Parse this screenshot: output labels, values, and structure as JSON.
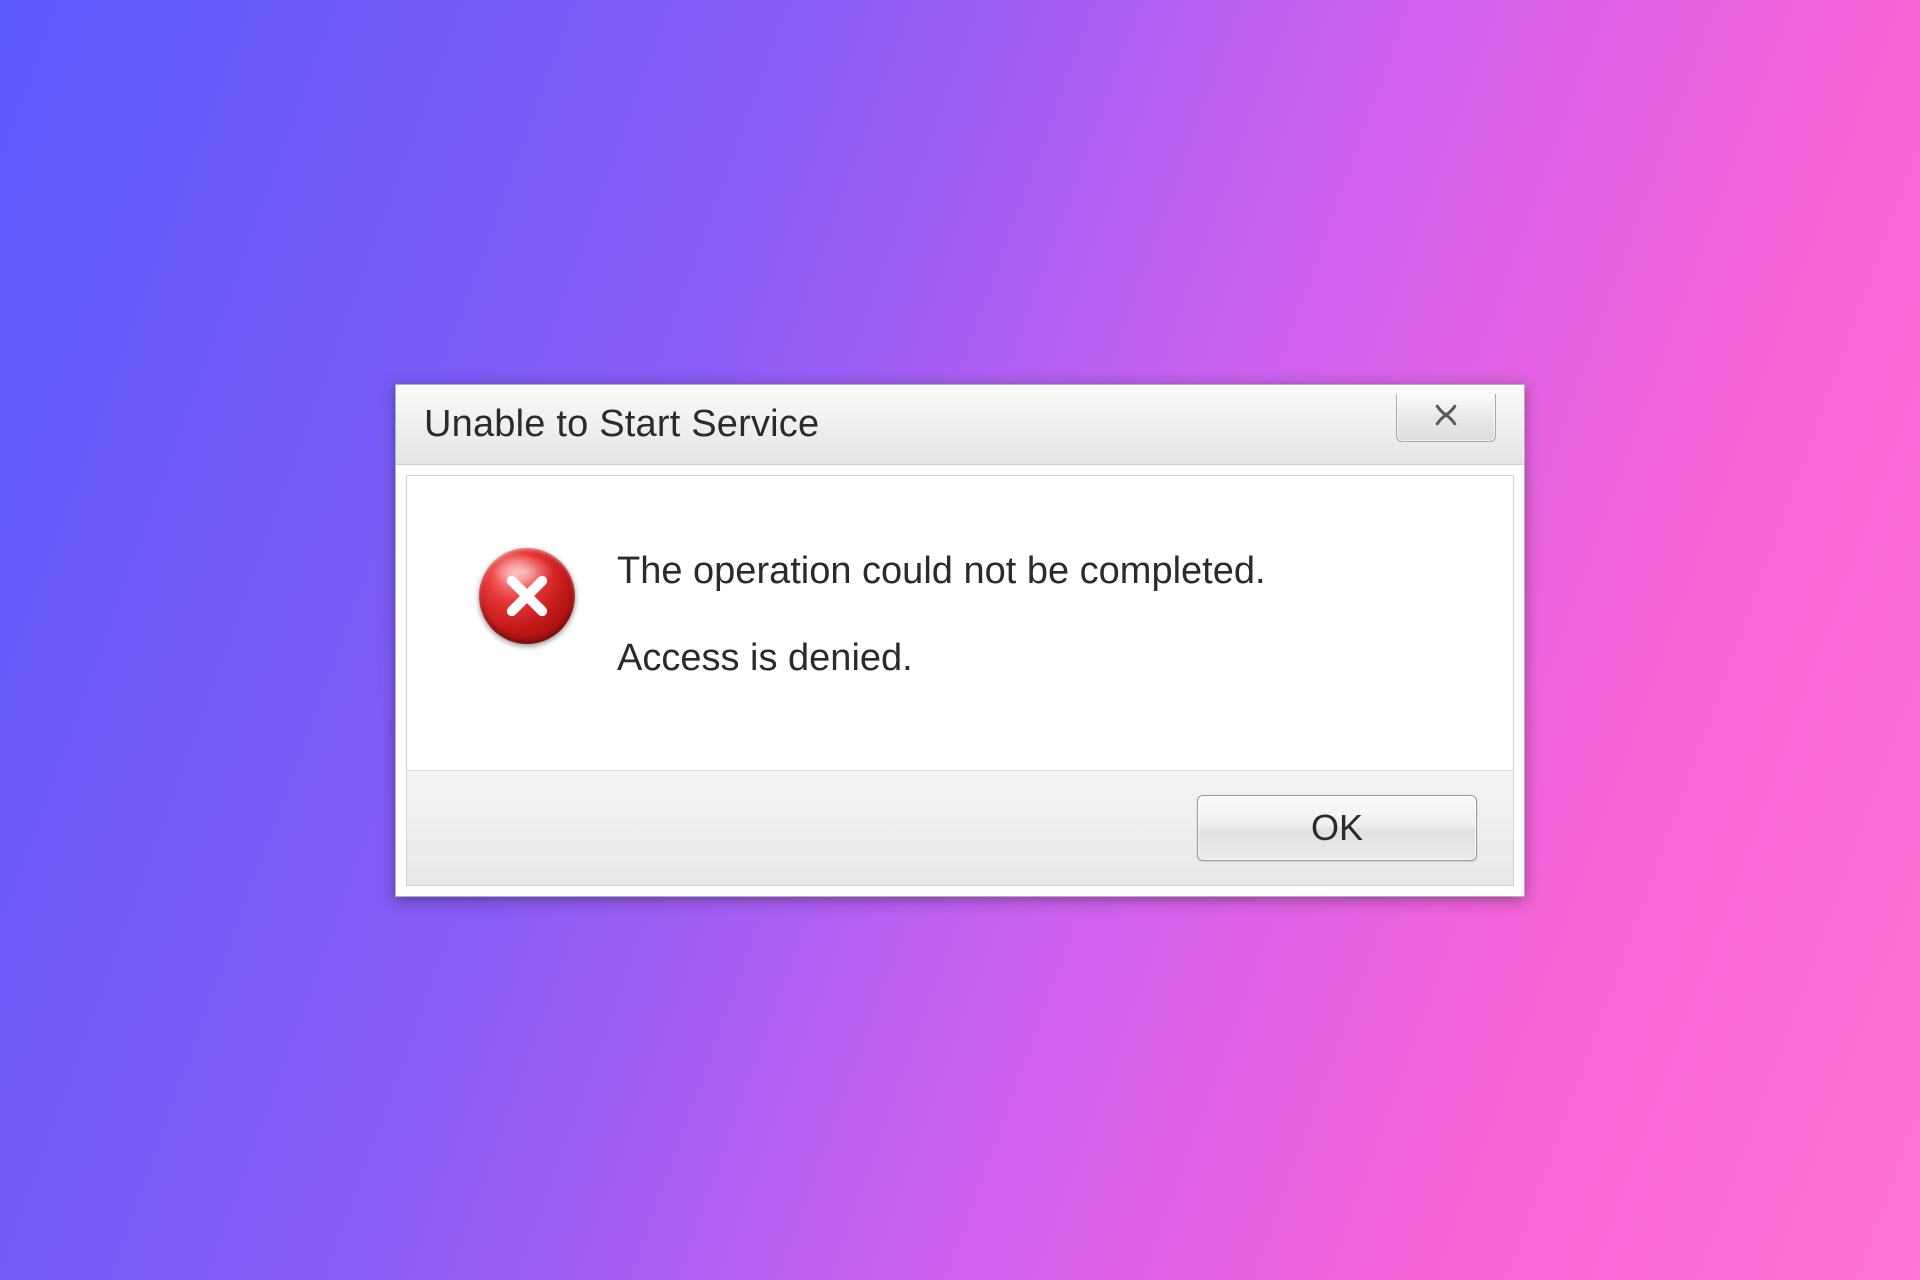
{
  "dialog": {
    "title": "Unable to Start Service",
    "message_primary": "The operation could not be completed.",
    "message_secondary": "Access is denied.",
    "ok_label": "OK"
  }
}
